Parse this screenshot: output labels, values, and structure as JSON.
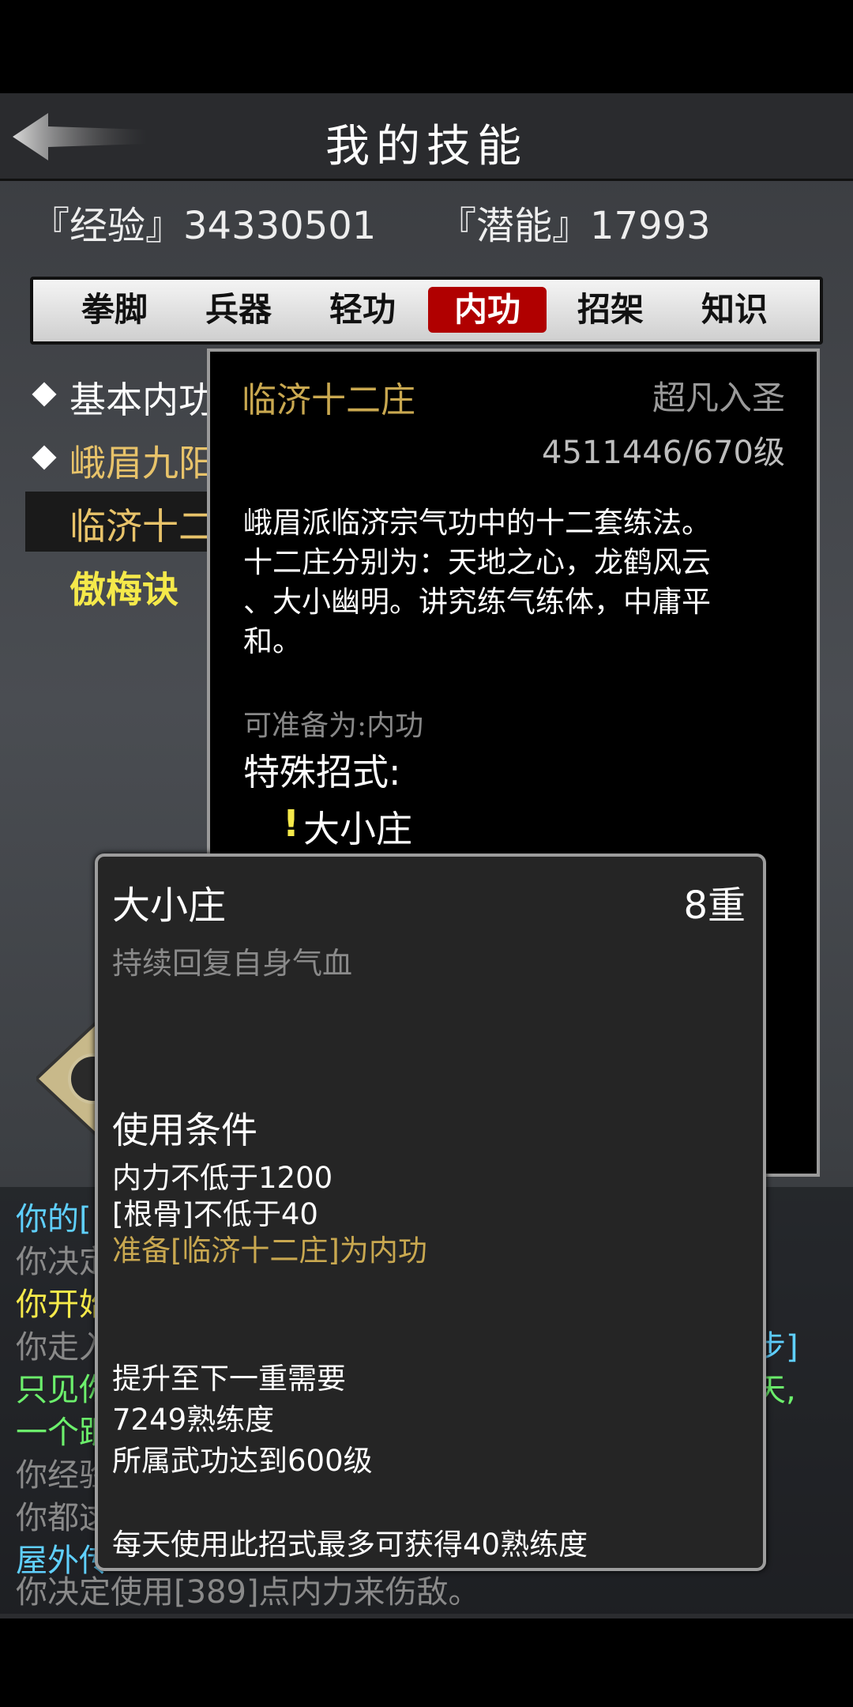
{
  "header": {
    "title": "我的技能",
    "back_icon": "back-arrow-icon"
  },
  "stats": {
    "exp_label": "『经验』34330501",
    "potential_label": "『潜能』17993"
  },
  "tabs": [
    {
      "label": "拳脚",
      "active": false
    },
    {
      "label": "兵器",
      "active": false
    },
    {
      "label": "轻功",
      "active": false
    },
    {
      "label": "内功",
      "active": true
    },
    {
      "label": "招架",
      "active": false
    },
    {
      "label": "知识",
      "active": false
    }
  ],
  "skill_list": [
    {
      "label": "基本内功",
      "color": "#ffffff"
    },
    {
      "label": "峨眉九阳",
      "color": "#e8c36a"
    },
    {
      "label": "临济十二庄",
      "color": "#e8c36a"
    },
    {
      "label": "傲梅诀",
      "color": "#f5e94a"
    }
  ],
  "detail": {
    "name": "临济十二庄",
    "rank": "超凡入圣",
    "level": "4511446/670级",
    "description": [
      "峨眉派临济宗气功中的十二套练法。",
      "十二庄分别为：天地之心，龙鹤风云",
      "、大小幽明。讲究练气练体，中庸平",
      "和。"
    ],
    "prepare": "可准备为:内功",
    "special_title": "特殊招式:",
    "special_mark": "!",
    "special_move": "大小庄"
  },
  "popup": {
    "name": "大小庄",
    "tier": "8重",
    "effect": "持续回复自身气血",
    "cond_title": "使用条件",
    "conditions": [
      "内力不低于1200",
      "[根骨]不低于40"
    ],
    "cond_highlight": "准备[临济十二庄]为内功",
    "upgrade_title": "提升至下一重需要",
    "upgrade_items": [
      "7249熟练度",
      "所属武功达到600级"
    ],
    "daily_note": "每天使用此招式最多可获得40熟练度"
  },
  "chat": [
    {
      "text": "你的[",
      "color": "#5fd0ff"
    },
    {
      "text": "你决定",
      "color": "#8a8a8a"
    },
    {
      "text": "你开始",
      "color": "#f5e94a"
    },
    {
      "text": "你走入",
      "color": "#8a8a8a"
    },
    {
      "text": "只见你",
      "color": "#6cf06c"
    },
    {
      "text": "一个跟",
      "color": "#6cf06c"
    },
    {
      "text": "你经验",
      "color": "#8a8a8a"
    },
    {
      "text": "你都这",
      "color": "#8a8a8a"
    },
    {
      "text": "屋外传",
      "color": "#5fd0ff"
    },
    {
      "text": "你决定使用[389]点内力来伤敌。",
      "color": "#8a8a8a"
    }
  ],
  "chat_fragments": {
    "line4_tail": "步]",
    "line5_tail": "天,"
  }
}
